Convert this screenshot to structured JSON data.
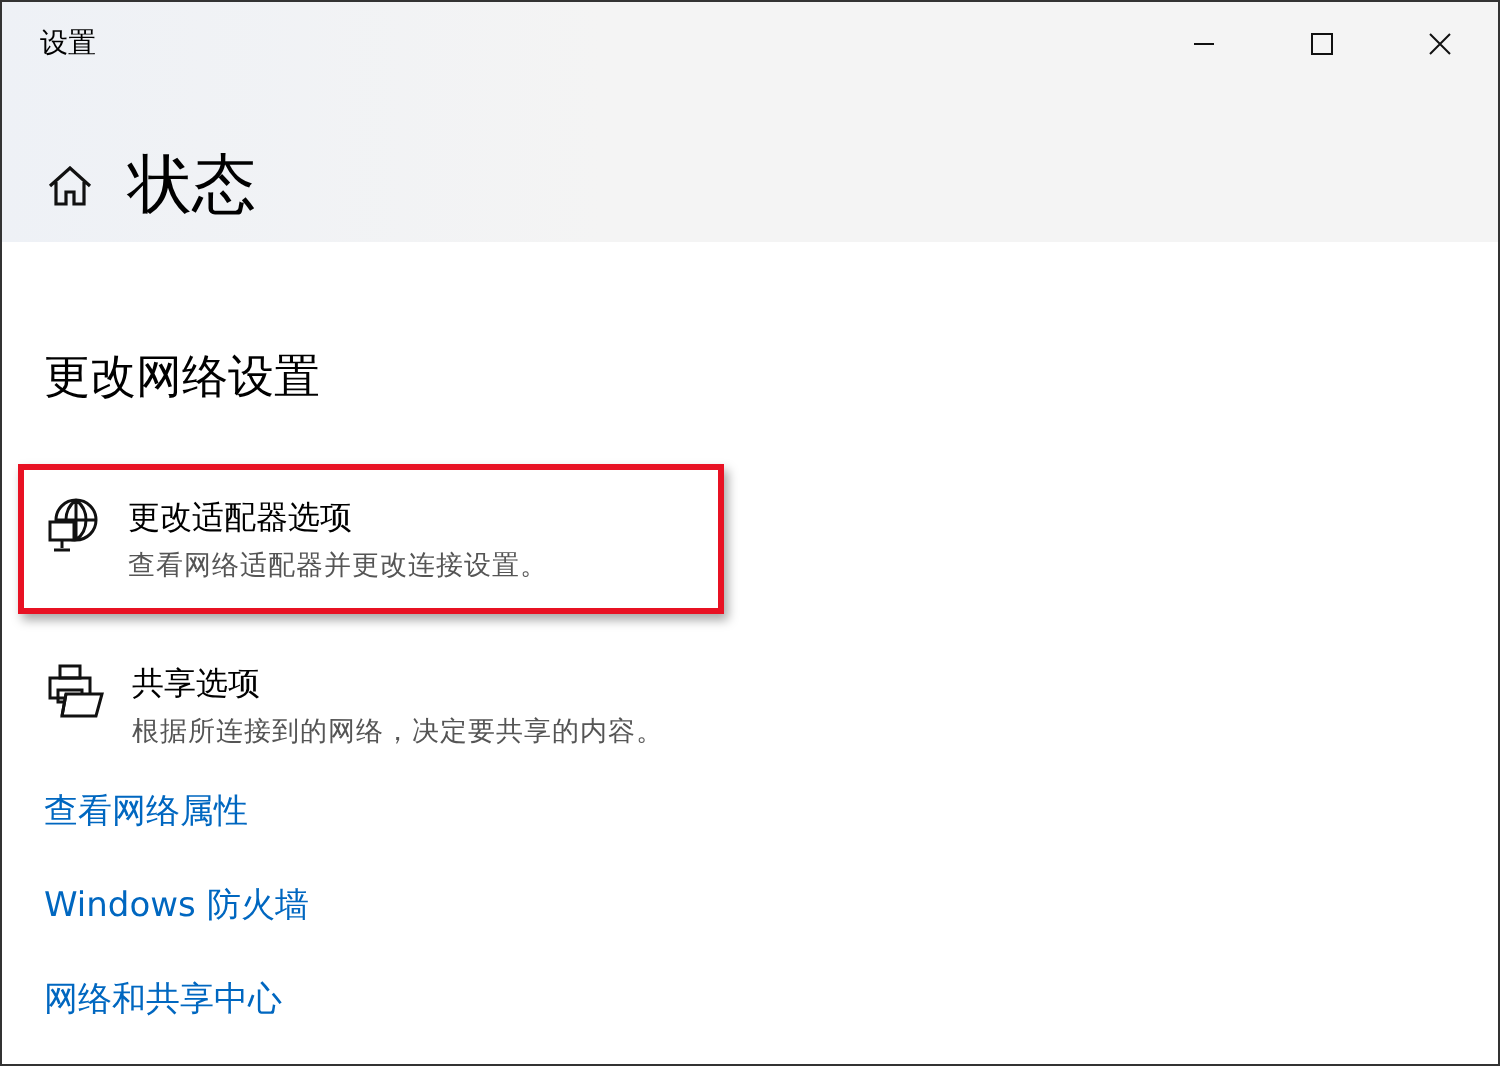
{
  "window": {
    "title": "设置"
  },
  "page": {
    "title": "状态"
  },
  "section": {
    "title": "更改网络设置"
  },
  "options": [
    {
      "title": "更改适配器选项",
      "description": "查看网络适配器并更改连接设置。",
      "highlighted": true
    },
    {
      "title": "共享选项",
      "description": "根据所连接到的网络，决定要共享的内容。",
      "highlighted": false
    }
  ],
  "links": [
    "查看网络属性",
    "Windows 防火墙",
    "网络和共享中心"
  ]
}
